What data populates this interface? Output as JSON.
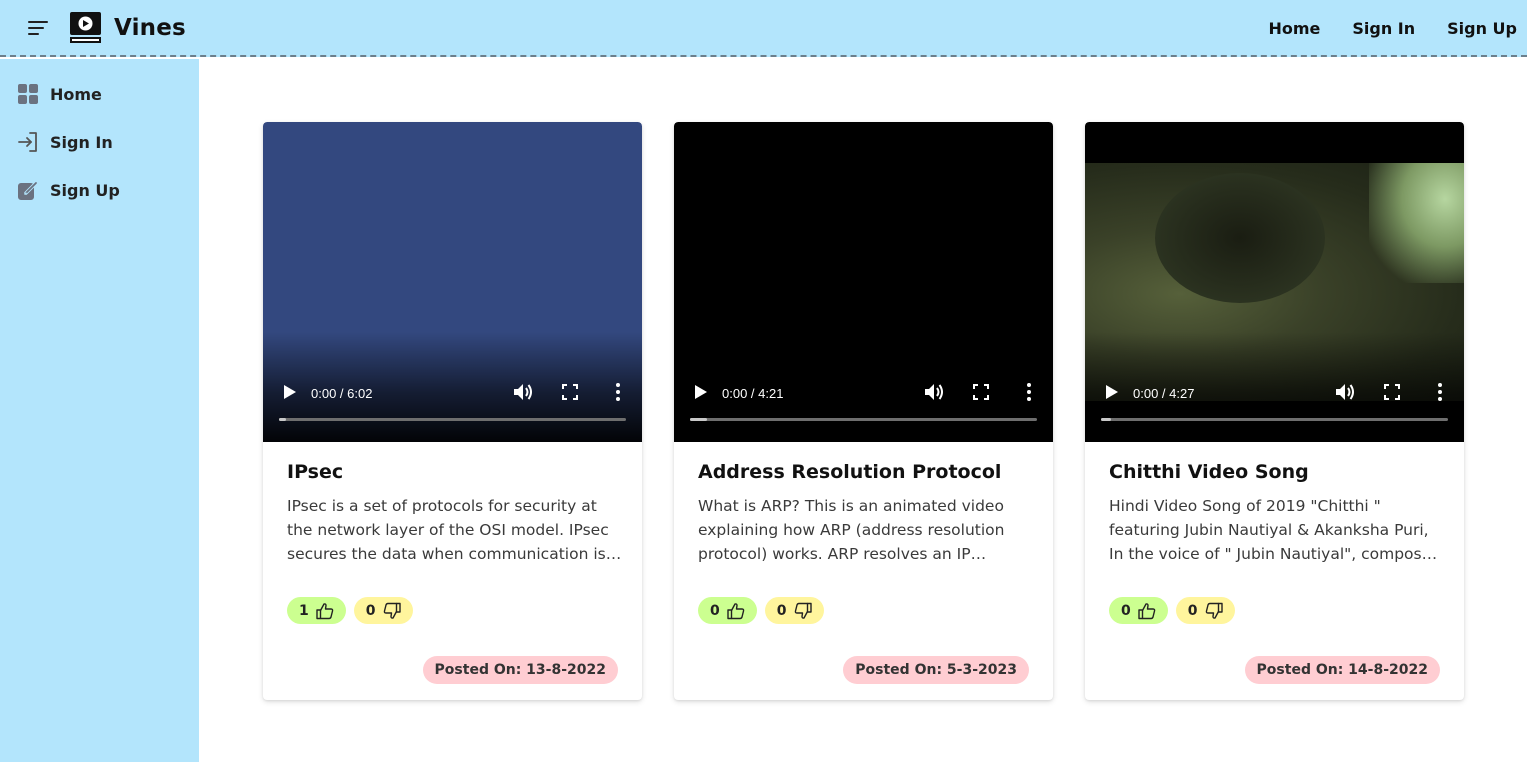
{
  "app": {
    "name": "Vines"
  },
  "header": {
    "nav": [
      "Home",
      "Sign In",
      "Sign Up"
    ]
  },
  "sidebar": {
    "items": [
      {
        "label": "Home",
        "icon": "dashboard-icon"
      },
      {
        "label": "Sign In",
        "icon": "login-icon"
      },
      {
        "label": "Sign Up",
        "icon": "signup-icon"
      }
    ]
  },
  "videos": [
    {
      "title": "IPsec",
      "description": "IPsec is a set of protocols for security at the network layer of the OSI model. IPsec secures the data when communication is happening between two devices over the internet.",
      "time": "0:00 / 6:02",
      "progress": 0.02,
      "likes": "1",
      "dislikes": "0",
      "posted": "Posted On: 13-8-2022",
      "poster": "blue"
    },
    {
      "title": "Address Resolution Protocol",
      "description": "What is ARP? This is an animated video explaining how ARP (address resolution protocol) works. ARP resolves an IP address to a MAC address.",
      "time": "0:00 / 4:21",
      "progress": 0.05,
      "likes": "0",
      "dislikes": "0",
      "posted": "Posted On: 5-3-2023",
      "poster": "black"
    },
    {
      "title": "Chitthi Video Song",
      "description": "Hindi Video Song of 2019 \"Chitthi \" featuring Jubin Nautiyal & Akanksha Puri, In the voice of \" Jubin Nautiyal\", composed by \"Khajanchi Mohan\".",
      "time": "0:00 / 4:27",
      "progress": 0.03,
      "likes": "0",
      "dislikes": "0",
      "posted": "Posted On: 14-8-2022",
      "poster": "scene"
    }
  ],
  "colors": {
    "header_bg": "#b3e5fc",
    "sidebar_bg": "#b3e5fc",
    "like_bg": "#ccff90",
    "dislike_bg": "#fff59d",
    "posted_bg": "#ffcdd2"
  }
}
